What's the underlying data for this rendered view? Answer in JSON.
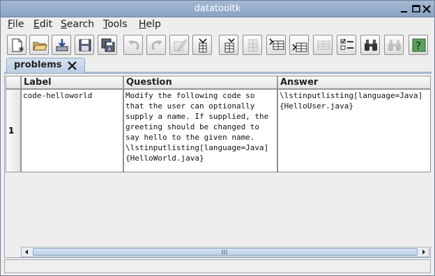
{
  "window": {
    "title": "datatooltk",
    "controls": [
      "minimize-icon",
      "maximize-icon",
      "close-icon"
    ]
  },
  "menubar": {
    "items": [
      {
        "label": "File",
        "mnemonic": "F",
        "rest": "ile"
      },
      {
        "label": "Edit",
        "mnemonic": "E",
        "rest": "dit"
      },
      {
        "label": "Search",
        "mnemonic": "S",
        "rest": "earch"
      },
      {
        "label": "Tools",
        "mnemonic": "T",
        "rest": "ools"
      },
      {
        "label": "Help",
        "mnemonic": "H",
        "rest": "elp"
      }
    ]
  },
  "toolbar": {
    "buttons": [
      {
        "icon": "new-document-icon",
        "enabled": true
      },
      {
        "icon": "open-folder-icon",
        "enabled": true
      },
      {
        "icon": "import-icon",
        "enabled": true
      },
      {
        "icon": "save-icon",
        "enabled": true
      },
      {
        "icon": "save-as-icon",
        "enabled": true
      },
      {
        "icon": "undo-icon",
        "enabled": false
      },
      {
        "icon": "redo-icon",
        "enabled": false
      },
      {
        "icon": "edit-cell-icon",
        "enabled": false
      },
      {
        "icon": "insert-column-before-icon",
        "enabled": true
      },
      {
        "icon": "insert-column-after-icon",
        "enabled": true
      },
      {
        "icon": "remove-column-icon",
        "enabled": false
      },
      {
        "icon": "insert-row-before-icon",
        "enabled": true
      },
      {
        "icon": "insert-row-after-icon",
        "enabled": true
      },
      {
        "icon": "remove-row-icon",
        "enabled": false
      },
      {
        "icon": "sort-icon",
        "enabled": true
      },
      {
        "icon": "find-icon",
        "enabled": true
      },
      {
        "icon": "find-again-icon",
        "enabled": false
      },
      {
        "icon": "help-icon",
        "enabled": true
      }
    ]
  },
  "tabs": [
    {
      "label": "problems",
      "closable": true,
      "selected": true
    }
  ],
  "table": {
    "columns": [
      "Label",
      "Question",
      "Answer"
    ],
    "rows": [
      {
        "row_number": "1",
        "cells": [
          "code-helloworld",
          "Modify the following code so\nthat the user can optionally\nsupply a name. If supplied, the\ngreeting should be changed to\nsay hello to the given name.\n\\lstinputlisting[language=Java]\n{HelloWorld.java}",
          "\\lstinputlisting[language=Java]\n{HelloUser.java}"
        ]
      }
    ]
  },
  "colors": {
    "titlebar": "#8aa3c4",
    "tab_selected": "#b9cde6",
    "window_bg": "#eeeeee"
  }
}
